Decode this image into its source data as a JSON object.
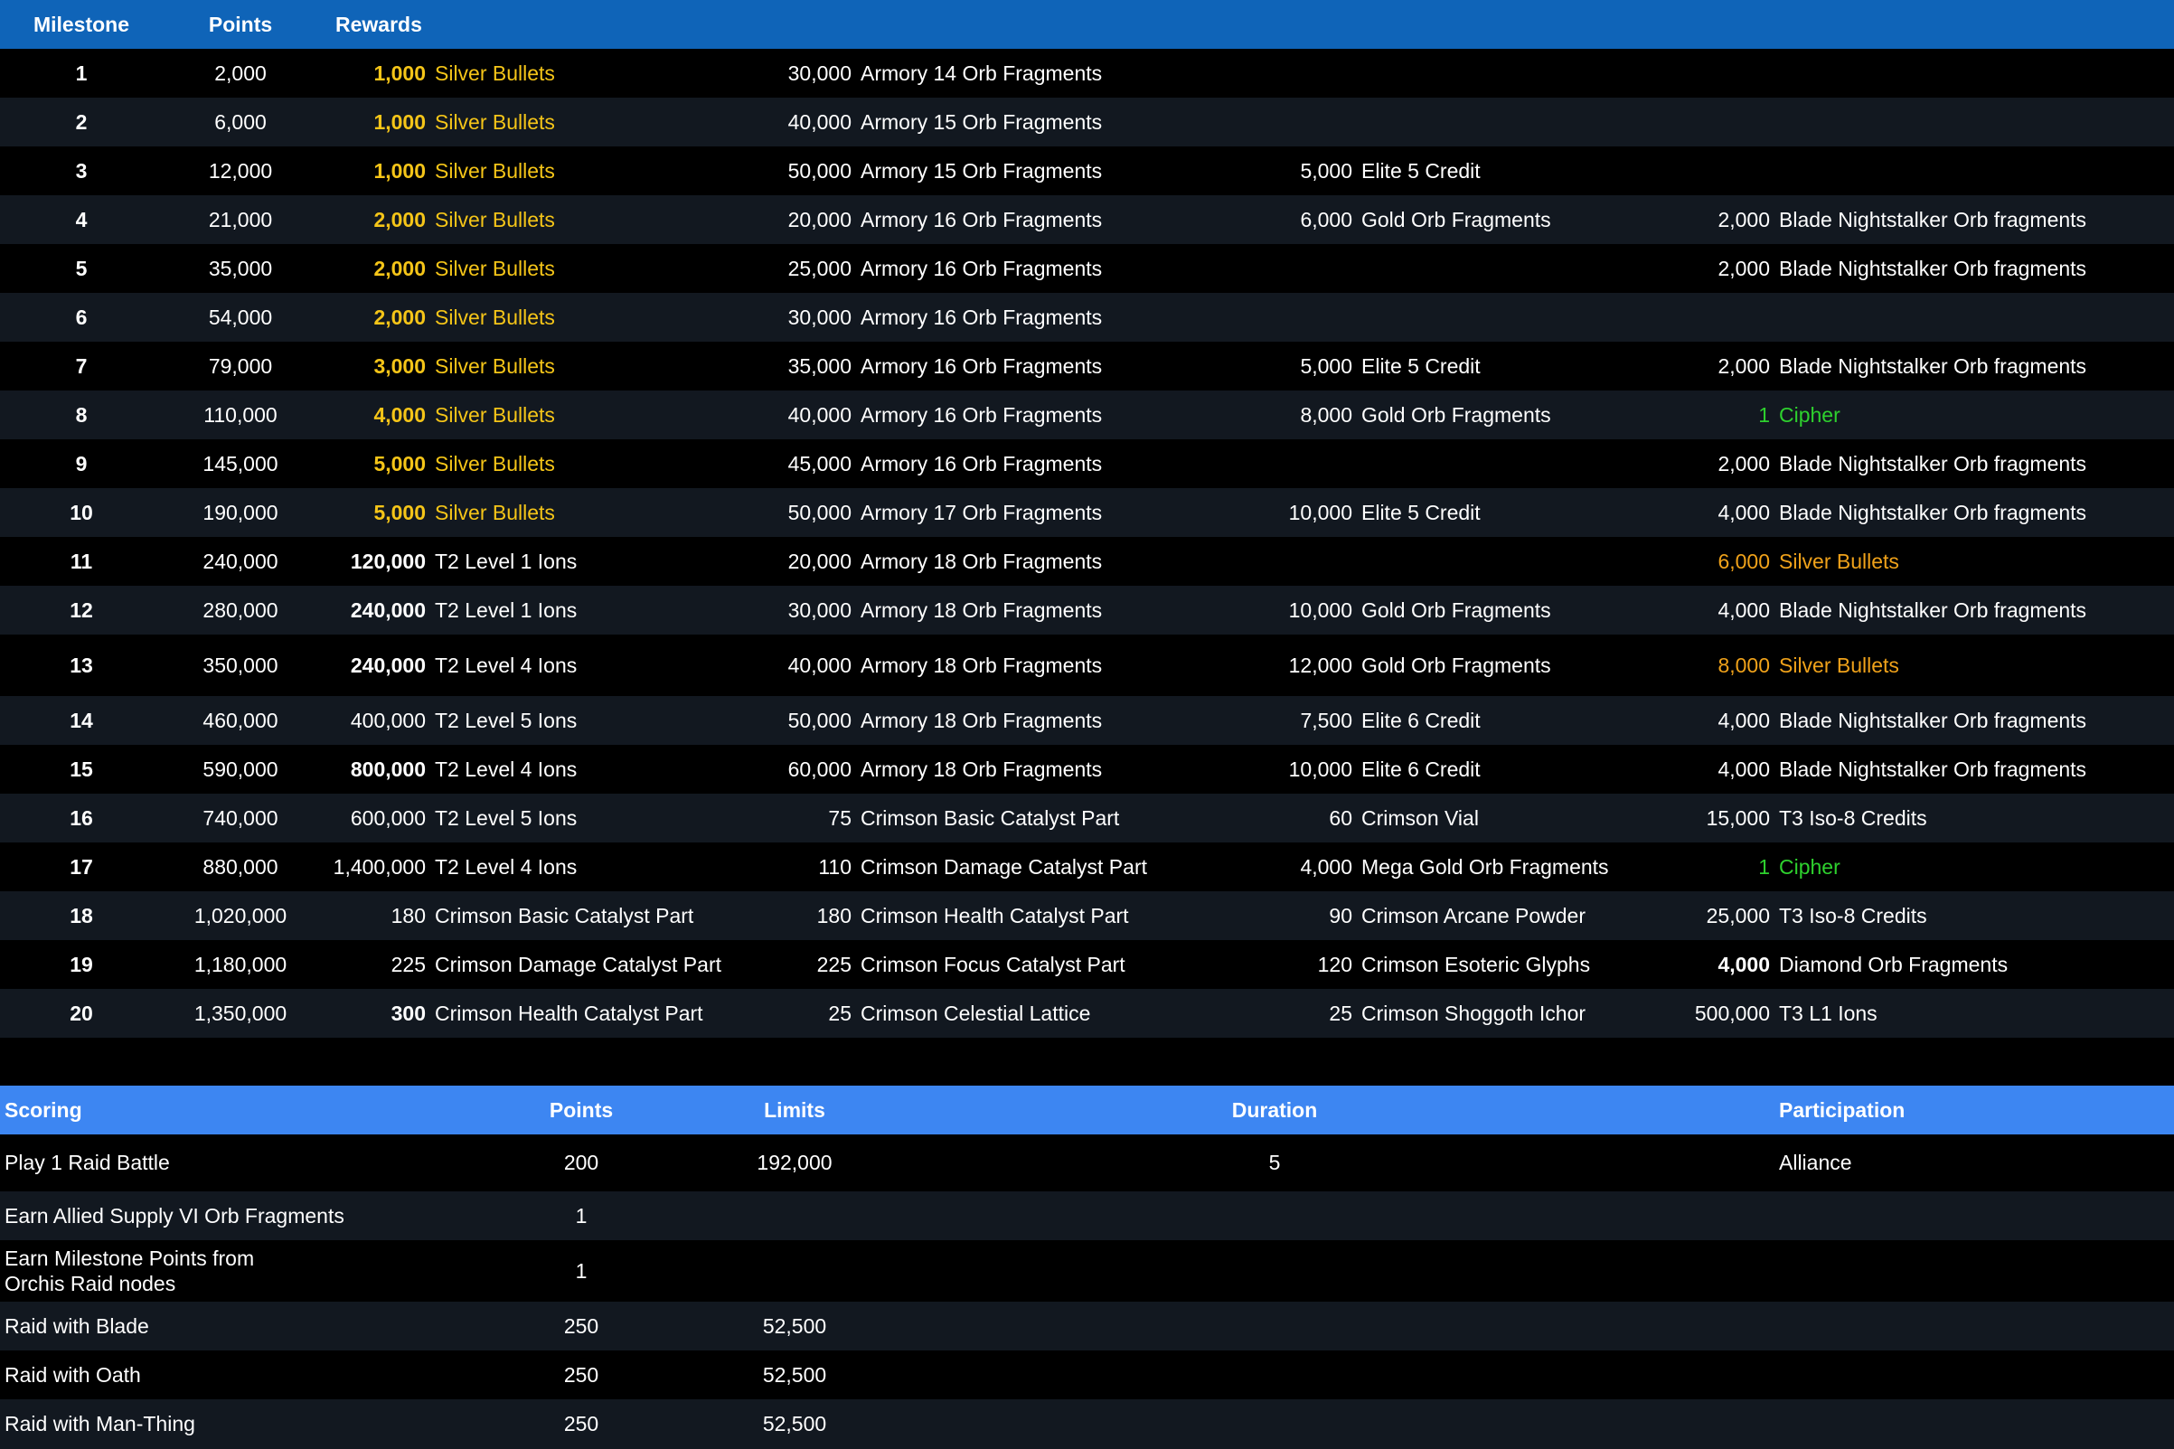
{
  "milestone_table": {
    "headers": {
      "milestone": "Milestone",
      "points": "Points",
      "rewards": "Rewards"
    },
    "rows": [
      {
        "milestone": "1",
        "points": "2,000",
        "r1": {
          "amount": "1,000",
          "name": "Silver Bullets",
          "color": "yellow",
          "bold": true
        },
        "r2": {
          "amount": "30,000",
          "name": "Armory 14 Orb Fragments"
        },
        "r3": null,
        "r4": null
      },
      {
        "milestone": "2",
        "points": "6,000",
        "r1": {
          "amount": "1,000",
          "name": "Silver Bullets",
          "color": "yellow",
          "bold": true
        },
        "r2": {
          "amount": "40,000",
          "name": "Armory 15 Orb Fragments"
        },
        "r3": null,
        "r4": null
      },
      {
        "milestone": "3",
        "points": "12,000",
        "r1": {
          "amount": "1,000",
          "name": "Silver Bullets",
          "color": "yellow",
          "bold": true
        },
        "r2": {
          "amount": "50,000",
          "name": "Armory 15 Orb Fragments"
        },
        "r3": {
          "amount": "5,000",
          "name": "Elite 5 Credit"
        },
        "r4": null
      },
      {
        "milestone": "4",
        "points": "21,000",
        "r1": {
          "amount": "2,000",
          "name": "Silver Bullets",
          "color": "yellow",
          "bold": true
        },
        "r2": {
          "amount": "20,000",
          "name": "Armory 16 Orb Fragments"
        },
        "r3": {
          "amount": "6,000",
          "name": "Gold Orb Fragments"
        },
        "r4": {
          "amount": "2,000",
          "name": "Blade Nightstalker Orb fragments"
        }
      },
      {
        "milestone": "5",
        "points": "35,000",
        "r1": {
          "amount": "2,000",
          "name": "Silver Bullets",
          "color": "yellow",
          "bold": true
        },
        "r2": {
          "amount": "25,000",
          "name": "Armory 16 Orb Fragments"
        },
        "r3": null,
        "r4": {
          "amount": "2,000",
          "name": "Blade Nightstalker Orb fragments"
        }
      },
      {
        "milestone": "6",
        "points": "54,000",
        "r1": {
          "amount": "2,000",
          "name": "Silver Bullets",
          "color": "yellow",
          "bold": true
        },
        "r2": {
          "amount": "30,000",
          "name": "Armory 16 Orb Fragments"
        },
        "r3": null,
        "r4": null
      },
      {
        "milestone": "7",
        "points": "79,000",
        "r1": {
          "amount": "3,000",
          "name": "Silver Bullets",
          "color": "yellow",
          "bold": true
        },
        "r2": {
          "amount": "35,000",
          "name": "Armory 16 Orb Fragments"
        },
        "r3": {
          "amount": "5,000",
          "name": "Elite 5 Credit"
        },
        "r4": {
          "amount": "2,000",
          "name": "Blade Nightstalker Orb fragments"
        }
      },
      {
        "milestone": "8",
        "points": "110,000",
        "r1": {
          "amount": "4,000",
          "name": "Silver Bullets",
          "color": "yellow",
          "bold": true
        },
        "r2": {
          "amount": "40,000",
          "name": "Armory 16 Orb Fragments"
        },
        "r3": {
          "amount": "8,000",
          "name": "Gold Orb Fragments"
        },
        "r4": {
          "amount": "1",
          "name": "Cipher",
          "color": "green"
        }
      },
      {
        "milestone": "9",
        "points": "145,000",
        "r1": {
          "amount": "5,000",
          "name": "Silver Bullets",
          "color": "yellow",
          "bold": true
        },
        "r2": {
          "amount": "45,000",
          "name": "Armory 16 Orb Fragments"
        },
        "r3": null,
        "r4": {
          "amount": "2,000",
          "name": "Blade Nightstalker Orb fragments"
        }
      },
      {
        "milestone": "10",
        "points": "190,000",
        "r1": {
          "amount": "5,000",
          "name": "Silver Bullets",
          "color": "yellow",
          "bold": true
        },
        "r2": {
          "amount": "50,000",
          "name": "Armory 17 Orb Fragments"
        },
        "r3": {
          "amount": "10,000",
          "name": "Elite 5 Credit"
        },
        "r4": {
          "amount": "4,000",
          "name": "Blade Nightstalker Orb fragments"
        }
      },
      {
        "milestone": "11",
        "points": "240,000",
        "r1": {
          "amount": "120,000",
          "name": "T2 Level 1 Ions",
          "bold": true
        },
        "r2": {
          "amount": "20,000",
          "name": "Armory 18 Orb Fragments"
        },
        "r3": null,
        "r4": {
          "amount": "6,000",
          "name": "Silver Bullets",
          "color": "orange"
        }
      },
      {
        "milestone": "12",
        "points": "280,000",
        "r1": {
          "amount": "240,000",
          "name": "T2 Level 1 Ions",
          "bold": true
        },
        "r2": {
          "amount": "30,000",
          "name": "Armory 18 Orb Fragments"
        },
        "r3": {
          "amount": "10,000",
          "name": "Gold Orb Fragments"
        },
        "r4": {
          "amount": "4,000",
          "name": "Blade Nightstalker Orb fragments"
        }
      },
      {
        "milestone": "13",
        "points": "350,000",
        "r1": {
          "amount": "240,000",
          "name": "T2 Level 4 Ions",
          "bold": true
        },
        "r2": {
          "amount": "40,000",
          "name": "Armory 18 Orb Fragments"
        },
        "r3": {
          "amount": "12,000",
          "name": "Gold Orb Fragments"
        },
        "r4": {
          "amount": "8,000",
          "name": "Silver Bullets",
          "color": "orange"
        }
      },
      {
        "milestone": "14",
        "points": "460,000",
        "r1": {
          "amount": "400,000",
          "name": "T2 Level 5 Ions"
        },
        "r2": {
          "amount": "50,000",
          "name": "Armory 18 Orb Fragments"
        },
        "r3": {
          "amount": "7,500",
          "name": "Elite 6 Credit"
        },
        "r4": {
          "amount": "4,000",
          "name": "Blade Nightstalker Orb fragments"
        }
      },
      {
        "milestone": "15",
        "points": "590,000",
        "r1": {
          "amount": "800,000",
          "name": "T2 Level 4 Ions",
          "bold": true
        },
        "r2": {
          "amount": "60,000",
          "name": "Armory 18 Orb Fragments"
        },
        "r3": {
          "amount": "10,000",
          "name": "Elite 6 Credit"
        },
        "r4": {
          "amount": "4,000",
          "name": "Blade Nightstalker Orb fragments"
        }
      },
      {
        "milestone": "16",
        "points": "740,000",
        "r1": {
          "amount": "600,000",
          "name": "T2 Level 5 Ions"
        },
        "r2": {
          "amount": "75",
          "name": "Crimson Basic Catalyst Part"
        },
        "r3": {
          "amount": "60",
          "name": "Crimson Vial"
        },
        "r4": {
          "amount": "15,000",
          "name": "T3 Iso-8 Credits"
        }
      },
      {
        "milestone": "17",
        "points": "880,000",
        "r1": {
          "amount": "1,400,000",
          "name": "T2 Level 4 Ions"
        },
        "r2": {
          "amount": "110",
          "name": "Crimson Damage Catalyst Part"
        },
        "r3": {
          "amount": "4,000",
          "name": "Mega Gold Orb Fragments"
        },
        "r4": {
          "amount": "1",
          "name": "Cipher",
          "color": "green"
        }
      },
      {
        "milestone": "18",
        "points": "1,020,000",
        "r1": {
          "amount": "180",
          "name": "Crimson Basic Catalyst Part"
        },
        "r2": {
          "amount": "180",
          "name": "Crimson Health Catalyst Part"
        },
        "r3": {
          "amount": "90",
          "name": "Crimson Arcane Powder"
        },
        "r4": {
          "amount": "25,000",
          "name": "T3 Iso-8 Credits"
        }
      },
      {
        "milestone": "19",
        "points": "1,180,000",
        "r1": {
          "amount": "225",
          "name": "Crimson Damage Catalyst Part"
        },
        "r2": {
          "amount": "225",
          "name": "Crimson Focus Catalyst Part"
        },
        "r3": {
          "amount": "120",
          "name": "Crimson Esoteric Glyphs"
        },
        "r4": {
          "amount": "4,000",
          "name": "Diamond Orb Fragments",
          "bold": true
        }
      },
      {
        "milestone": "20",
        "points": "1,350,000",
        "r1": {
          "amount": "300",
          "name": "Crimson Health Catalyst Part",
          "bold": true
        },
        "r2": {
          "amount": "25",
          "name": "Crimson Celestial Lattice"
        },
        "r3": {
          "amount": "25",
          "name": "Crimson Shoggoth Ichor"
        },
        "r4": {
          "amount": "500,000",
          "name": "T3 L1 Ions"
        }
      }
    ]
  },
  "scoring_table": {
    "headers": {
      "scoring": "Scoring",
      "points": "Points",
      "limits": "Limits",
      "duration": "Duration",
      "participation": "Participation"
    },
    "rows": [
      {
        "scoring": [
          "Play 1 Raid Battle"
        ],
        "points": "200",
        "limits": "192,000",
        "duration": "5",
        "participation": "Alliance"
      },
      {
        "scoring": [
          "Earn Allied Supply VI Orb Fragments"
        ],
        "points": "1",
        "limits": "",
        "duration": "",
        "participation": ""
      },
      {
        "scoring": [
          "Earn Milestone Points from",
          "Orchis Raid nodes"
        ],
        "points": "1",
        "limits": "",
        "duration": "",
        "participation": ""
      },
      {
        "scoring": [
          "Raid with Blade"
        ],
        "points": "250",
        "limits": "52,500",
        "duration": "",
        "participation": ""
      },
      {
        "scoring": [
          "Raid with Oath"
        ],
        "points": "250",
        "limits": "52,500",
        "duration": "",
        "participation": ""
      },
      {
        "scoring": [
          "Raid with Man-Thing"
        ],
        "points": "250",
        "limits": "52,500",
        "duration": "",
        "participation": ""
      }
    ]
  },
  "colors": {
    "milestone_header_bg": "#0f64b8",
    "scoring_header_bg": "#3d86f2",
    "row_dark": "#000000",
    "row_alt": "#121820",
    "yellow": "#f5c518",
    "orange": "#f0a21a",
    "green": "#2ed12e"
  }
}
